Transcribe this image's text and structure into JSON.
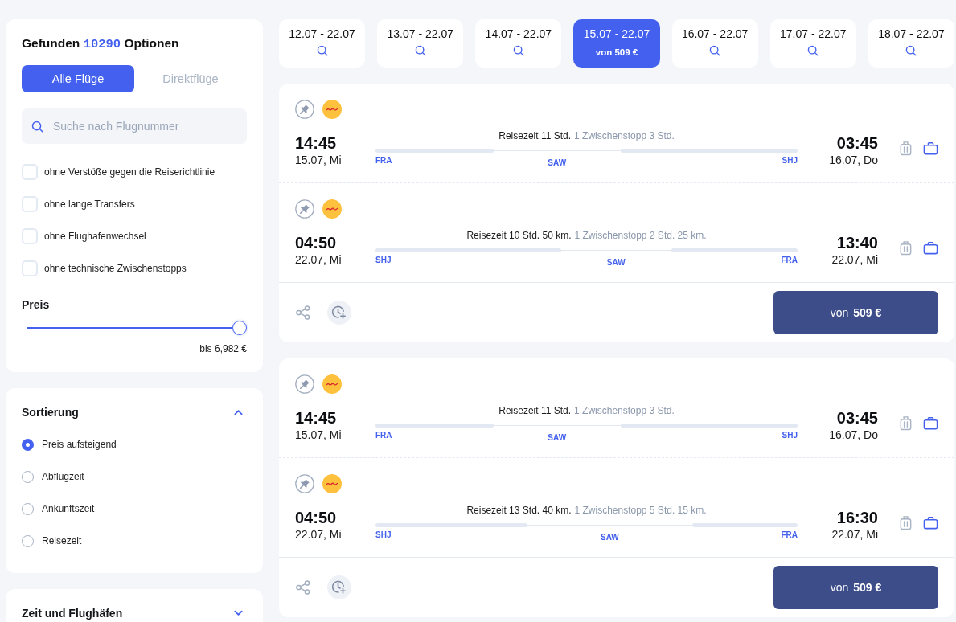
{
  "filters": {
    "heading": {
      "prefix": "Gefunden",
      "count": "10290",
      "suffix": "Optionen"
    },
    "flight_type_tabs": [
      {
        "label": "Alle Flüge",
        "selected": true
      },
      {
        "label": "Direktflüge",
        "selected": false
      }
    ],
    "search": {
      "placeholder": "Suche nach Flugnummer"
    },
    "options": [
      {
        "label": "ohne Verstöße gegen die Reiserichtlinie",
        "checked": false
      },
      {
        "label": "ohne lange Transfers",
        "checked": false
      },
      {
        "label": "ohne Flughafenwechsel",
        "checked": false
      },
      {
        "label": "ohne technische Zwischenstopps",
        "checked": false
      }
    ],
    "price": {
      "title": "Preis",
      "level": 1,
      "reading": "bis 6,982 €"
    }
  },
  "sorting": {
    "title": "Sortierung",
    "expanded": true,
    "options": [
      {
        "label": "Preis aufsteigend",
        "selected": true
      },
      {
        "label": "Abflugzeit",
        "selected": false
      },
      {
        "label": "Ankunftszeit",
        "selected": false
      },
      {
        "label": "Reisezeit",
        "selected": false
      }
    ]
  },
  "time_airports": {
    "title": "Zeit und Flughäfen",
    "expanded": false
  },
  "date_tabs": [
    {
      "label": "12.07 - 22.07",
      "selected": false
    },
    {
      "label": "13.07 - 22.07",
      "selected": false
    },
    {
      "label": "14.07 - 22.07",
      "selected": false
    },
    {
      "label": "15.07 - 22.07",
      "selected": true,
      "price": "von 509 €"
    },
    {
      "label": "16.07 - 22.07",
      "selected": false
    },
    {
      "label": "17.07 - 22.07",
      "selected": false
    },
    {
      "label": "18.07 - 22.07",
      "selected": false
    }
  ],
  "results": [
    {
      "segments": [
        {
          "departure_time": "14:45",
          "departure_date": "15.07, Mi",
          "duration": "Reisezeit 11 Std.",
          "stops": "1 Zwischenstopp 3 Std.",
          "airports": [
            "FRA",
            "SAW",
            "SHJ"
          ],
          "legs": [
            {
              "level": 0.28
            },
            {
              "level": 0.42
            }
          ],
          "arrival_time": "03:45",
          "arrival_date": "16.07, Do"
        },
        {
          "departure_time": "04:50",
          "departure_date": "22.07, Mi",
          "duration": "Reisezeit 10 Std. 50 km.",
          "stops": "1 Zwischenstopp 2 Std. 25 km.",
          "airports": [
            "SHJ",
            "SAW",
            "FRA"
          ],
          "legs": [
            {
              "level": 0.44
            },
            {
              "level": 0.3
            }
          ],
          "arrival_time": "13:40",
          "arrival_date": "22.07, Mi"
        }
      ],
      "price": "von **509 €**"
    },
    {
      "segments": [
        {
          "departure_time": "14:45",
          "departure_date": "15.07, Mi",
          "duration": "Reisezeit 11 Std.",
          "stops": "1 Zwischenstopp 3 Std.",
          "airports": [
            "FRA",
            "SAW",
            "SHJ"
          ],
          "legs": [
            {
              "level": 0.28
            },
            {
              "level": 0.42
            }
          ],
          "arrival_time": "03:45",
          "arrival_date": "16.07, Do"
        },
        {
          "departure_time": "04:50",
          "departure_date": "22.07, Mi",
          "duration": "Reisezeit 13 Std. 40 km.",
          "stops": "1 Zwischenstopp 5 Std. 15 km.",
          "airports": [
            "SHJ",
            "SAW",
            "FRA"
          ],
          "legs": [
            {
              "level": 0.36
            },
            {
              "level": 0.25
            }
          ],
          "arrival_time": "16:30",
          "arrival_date": "22.07, Mi"
        }
      ],
      "price": "von **509 €**"
    }
  ]
}
